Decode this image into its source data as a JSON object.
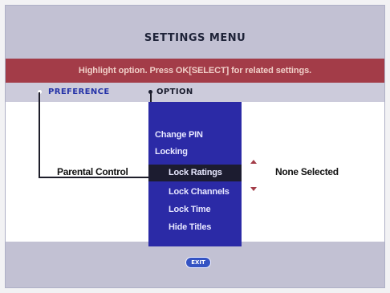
{
  "menu": {
    "title": "SETTINGS MENU",
    "instruction": "Highlight option. Press OK[SELECT] for related settings."
  },
  "columns": {
    "preference": "PREFERENCE",
    "option": "OPTION"
  },
  "preference": {
    "label": "Parental Control"
  },
  "options": [
    {
      "label": "Change PIN",
      "level": 1
    },
    {
      "label": "Locking",
      "level": 1
    },
    {
      "label": "Lock Ratings",
      "level": 2,
      "selected": true
    },
    {
      "label": "Lock Channels",
      "level": 2
    },
    {
      "label": "Lock Time",
      "level": 2
    },
    {
      "label": "Hide Titles",
      "level": 2
    }
  ],
  "value": {
    "label": "None Selected"
  },
  "buttons": {
    "exit": "EXIT"
  },
  "colors": {
    "banner": "#a33c48",
    "option_panel": "#2b2aa6",
    "selected_row": "#1c1c30",
    "preference_column": "#2533a8"
  },
  "icons": {
    "lock": "lock-icon",
    "scroll_up": "arrow-up-icon",
    "scroll_down": "arrow-down-icon"
  }
}
